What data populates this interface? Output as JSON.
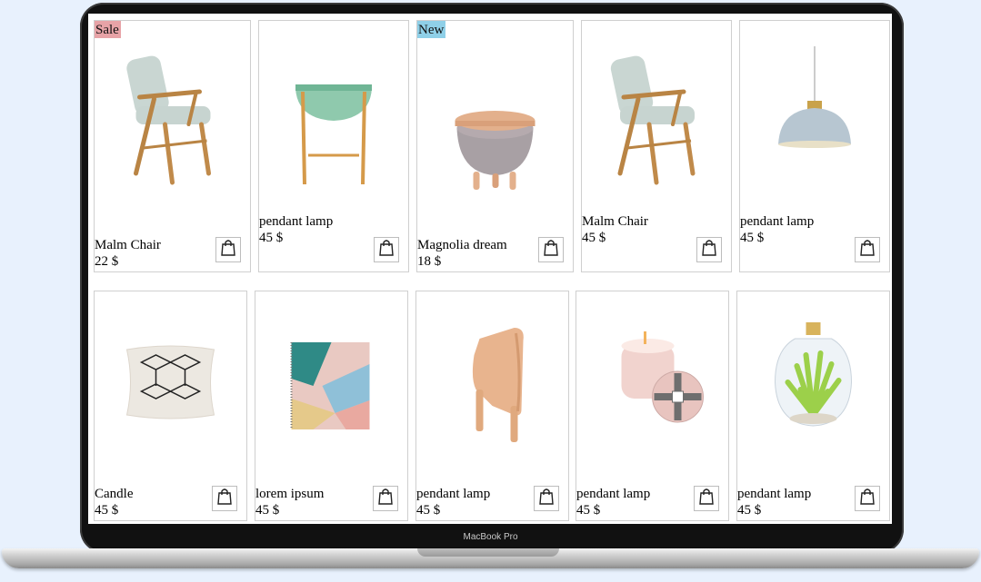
{
  "device": {
    "label": "MacBook Pro"
  },
  "cart_icon": "shopping-bag-icon",
  "products": [
    {
      "name": "Malm Chair",
      "price": "22 $",
      "badge": "Sale",
      "image": "armchair"
    },
    {
      "name": "pendant lamp",
      "price": "45 $",
      "badge": "",
      "image": "side-table"
    },
    {
      "name": "Magnolia dream",
      "price": "18 $",
      "badge": "New",
      "image": "pouf"
    },
    {
      "name": "Malm Chair",
      "price": "45 $",
      "badge": "",
      "image": "armchair"
    },
    {
      "name": "pendant lamp",
      "price": "45 $",
      "badge": "",
      "image": "pendant-lamp"
    },
    {
      "name": "Candle",
      "price": "45 $",
      "badge": "",
      "image": "cushion"
    },
    {
      "name": "lorem ipsum",
      "price": "45 $",
      "badge": "",
      "image": "blanket"
    },
    {
      "name": "pendant lamp",
      "price": "45 $",
      "badge": "",
      "image": "wooden-elephant"
    },
    {
      "name": "pendant lamp",
      "price": "45 $",
      "badge": "",
      "image": "candle-jar"
    },
    {
      "name": "pendant lamp",
      "price": "45 $",
      "badge": "",
      "image": "plant-bulb"
    }
  ],
  "colors": {
    "sale_badge": "#e7a3a7",
    "new_badge": "#8fd0e8",
    "background": "#e8f1fd"
  }
}
